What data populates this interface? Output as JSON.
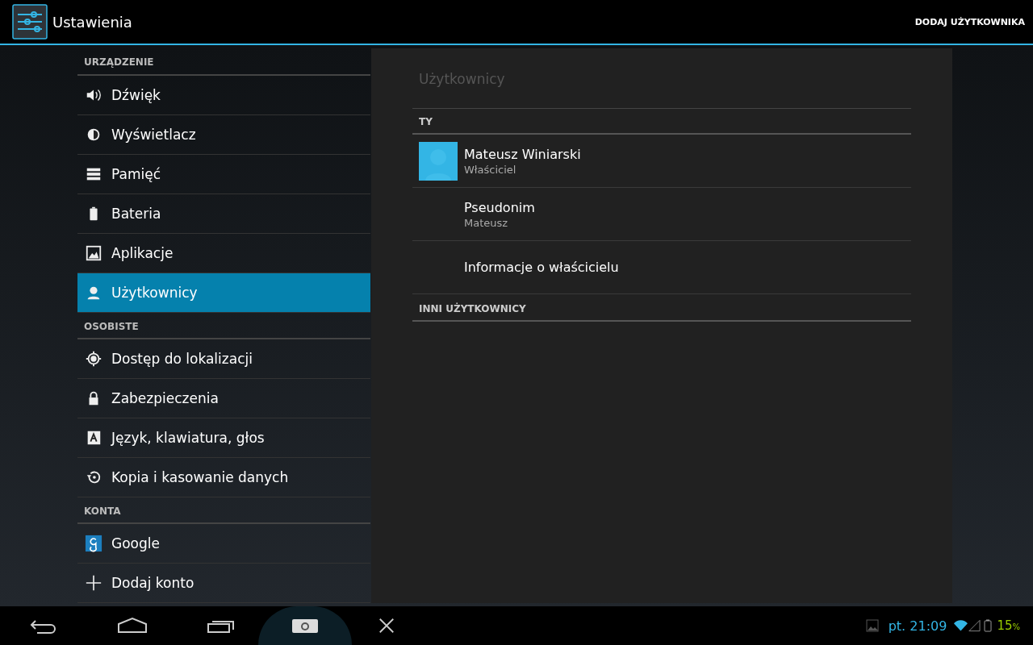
{
  "action_bar": {
    "title": "Ustawienia",
    "action": "DODAJ UŻYTKOWNIKA"
  },
  "sidebar": {
    "sections": [
      {
        "title": "URZĄDZENIE",
        "items": [
          {
            "label": "Dźwięk",
            "selected": false
          },
          {
            "label": "Wyświetlacz",
            "selected": false
          },
          {
            "label": "Pamięć",
            "selected": false
          },
          {
            "label": "Bateria",
            "selected": false
          },
          {
            "label": "Aplikacje",
            "selected": false
          },
          {
            "label": "Użytkownicy",
            "selected": true
          }
        ]
      },
      {
        "title": "OSOBISTE",
        "items": [
          {
            "label": "Dostęp do lokalizacji",
            "selected": false
          },
          {
            "label": "Zabezpieczenia",
            "selected": false
          },
          {
            "label": "Język, klawiatura, głos",
            "selected": false
          },
          {
            "label": "Kopia i kasowanie danych",
            "selected": false
          }
        ]
      },
      {
        "title": "KONTA",
        "items": [
          {
            "label": "Google",
            "selected": false
          },
          {
            "label": "Dodaj konto",
            "selected": false
          }
        ]
      }
    ]
  },
  "panel": {
    "title": "Użytkownicy",
    "groups": [
      {
        "title": "TY",
        "rows": [
          {
            "kind": "user",
            "title": "Mateusz Winiarski",
            "summary": "Właściciel"
          },
          {
            "kind": "plain",
            "title": "Pseudonim",
            "summary": "Mateusz"
          },
          {
            "kind": "plain",
            "title": "Informacje o właścicielu"
          }
        ]
      },
      {
        "title": "INNI UŻYTKOWNICY"
      }
    ]
  },
  "status_bar": {
    "time": "pt. 21:09",
    "battery": "15",
    "battery_unit": "%"
  }
}
